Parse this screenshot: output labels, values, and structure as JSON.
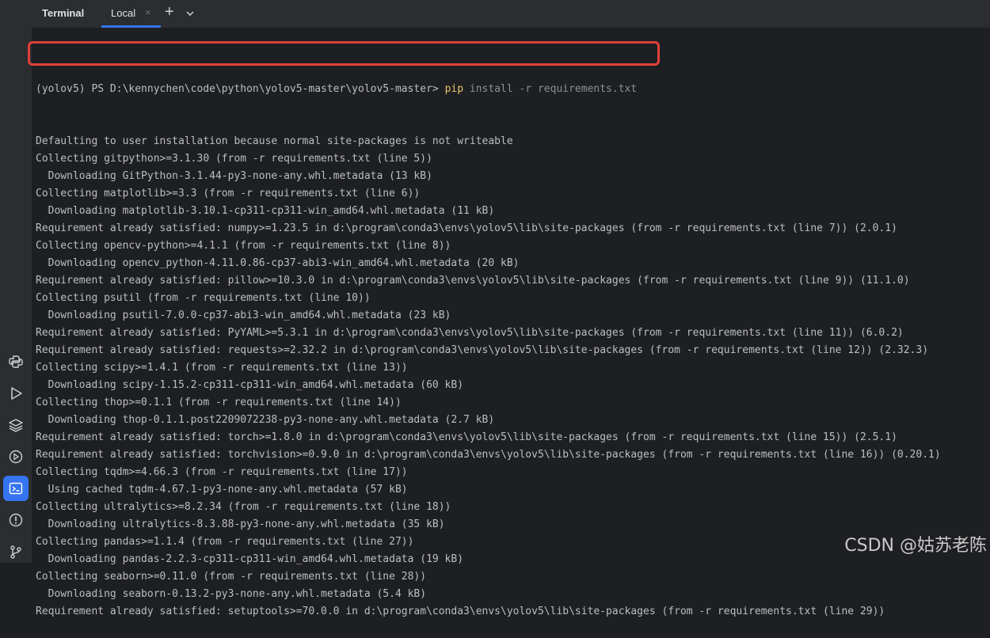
{
  "header": {
    "title": "Terminal",
    "tab_label": "Local",
    "close_glyph": "×",
    "add_glyph": "+"
  },
  "sidebar": {
    "icons": [
      "python-console-icon",
      "run-icon",
      "layers-icon",
      "services-icon",
      "terminal-icon",
      "problems-icon",
      "git-icon"
    ],
    "active": "terminal-icon"
  },
  "terminal": {
    "prompt": "(yolov5) PS D:\\kennychen\\code\\python\\yolov5-master\\yolov5-master> ",
    "command_head": "pip",
    "command_rest": " install -r requirements.txt",
    "lines": [
      "Defaulting to user installation because normal site-packages is not writeable",
      "Collecting gitpython>=3.1.30 (from -r requirements.txt (line 5))",
      "  Downloading GitPython-3.1.44-py3-none-any.whl.metadata (13 kB)",
      "Collecting matplotlib>=3.3 (from -r requirements.txt (line 6))",
      "  Downloading matplotlib-3.10.1-cp311-cp311-win_amd64.whl.metadata (11 kB)",
      "Requirement already satisfied: numpy>=1.23.5 in d:\\program\\conda3\\envs\\yolov5\\lib\\site-packages (from -r requirements.txt (line 7)) (2.0.1)",
      "Collecting opencv-python>=4.1.1 (from -r requirements.txt (line 8))",
      "  Downloading opencv_python-4.11.0.86-cp37-abi3-win_amd64.whl.metadata (20 kB)",
      "Requirement already satisfied: pillow>=10.3.0 in d:\\program\\conda3\\envs\\yolov5\\lib\\site-packages (from -r requirements.txt (line 9)) (11.1.0)",
      "Collecting psutil (from -r requirements.txt (line 10))",
      "  Downloading psutil-7.0.0-cp37-abi3-win_amd64.whl.metadata (23 kB)",
      "Requirement already satisfied: PyYAML>=5.3.1 in d:\\program\\conda3\\envs\\yolov5\\lib\\site-packages (from -r requirements.txt (line 11)) (6.0.2)",
      "Requirement already satisfied: requests>=2.32.2 in d:\\program\\conda3\\envs\\yolov5\\lib\\site-packages (from -r requirements.txt (line 12)) (2.32.3)",
      "Collecting scipy>=1.4.1 (from -r requirements.txt (line 13))",
      "  Downloading scipy-1.15.2-cp311-cp311-win_amd64.whl.metadata (60 kB)",
      "Collecting thop>=0.1.1 (from -r requirements.txt (line 14))",
      "  Downloading thop-0.1.1.post2209072238-py3-none-any.whl.metadata (2.7 kB)",
      "Requirement already satisfied: torch>=1.8.0 in d:\\program\\conda3\\envs\\yolov5\\lib\\site-packages (from -r requirements.txt (line 15)) (2.5.1)",
      "Requirement already satisfied: torchvision>=0.9.0 in d:\\program\\conda3\\envs\\yolov5\\lib\\site-packages (from -r requirements.txt (line 16)) (0.20.1)",
      "Collecting tqdm>=4.66.3 (from -r requirements.txt (line 17))",
      "  Using cached tqdm-4.67.1-py3-none-any.whl.metadata (57 kB)",
      "Collecting ultralytics>=8.2.34 (from -r requirements.txt (line 18))",
      "  Downloading ultralytics-8.3.88-py3-none-any.whl.metadata (35 kB)",
      "Collecting pandas>=1.1.4 (from -r requirements.txt (line 27))",
      "  Downloading pandas-2.2.3-cp311-cp311-win_amd64.whl.metadata (19 kB)",
      "Collecting seaborn>=0.11.0 (from -r requirements.txt (line 28))",
      "  Downloading seaborn-0.13.2-py3-none-any.whl.metadata (5.4 kB)",
      "Requirement already satisfied: setuptools>=70.0.0 in d:\\program\\conda3\\envs\\yolov5\\lib\\site-packages (from -r requirements.txt (line 29))"
    ]
  },
  "watermark": "CSDN @姑苏老陈",
  "colors": {
    "background": "#1e1f22",
    "text": "#bcbec4",
    "highlight_box": "#e0403a",
    "accent": "#3574f0"
  }
}
